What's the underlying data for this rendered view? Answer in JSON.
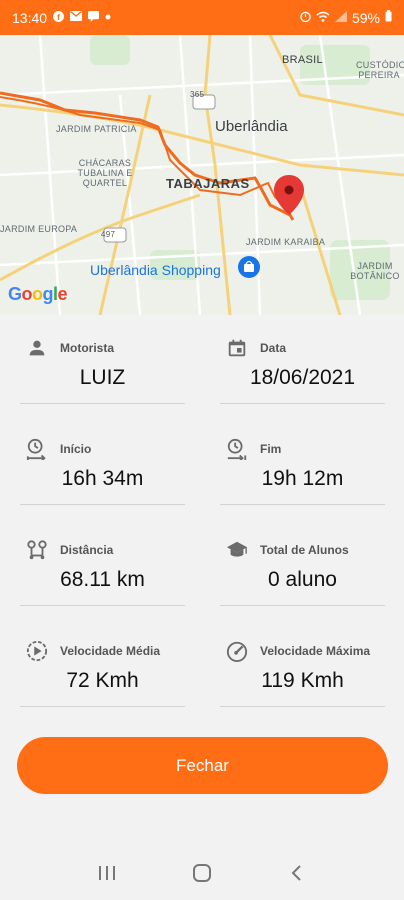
{
  "status_bar": {
    "time": "13:40",
    "battery": "59%",
    "left_icons": [
      "facebook-icon",
      "mail-icon",
      "message-icon",
      "dot-icon"
    ],
    "right_icons": [
      "alarm-icon",
      "wifi-icon",
      "signal-icon",
      "battery-icon"
    ]
  },
  "map": {
    "labels": {
      "brasil": "BRASIL",
      "custodio": "CUSTÓDIO PEREIRA",
      "jardim_patricia": "JARDIM PATRICIA",
      "uberlandia": "Uberlândia",
      "chacaras": "CHÁCARAS TUBALINA E QUARTEL",
      "tabajaras": "TABAJARAS",
      "jardim_europa": "JARDIM EUROPA",
      "jardim_karaiba": "JARDIM KARAIBA",
      "jardim_botanico": "JARDIM BOTÂNICO",
      "shopping": "Uberlândia Shopping",
      "road_365": "365",
      "road_497": "497"
    },
    "google": {
      "letters": [
        "G",
        "o",
        "o",
        "g",
        "l",
        "e"
      ],
      "colors": [
        "#4285F4",
        "#EA4335",
        "#FBBC05",
        "#4285F4",
        "#34A853",
        "#EA4335"
      ]
    },
    "route_color": "#ef6c1e",
    "marker_color": "#e53935"
  },
  "details": {
    "driver": {
      "label": "Motorista",
      "value": "LUIZ",
      "icon": "person-icon"
    },
    "date": {
      "label": "Data",
      "value": "18/06/2021",
      "icon": "calendar-icon"
    },
    "start": {
      "label": "Início",
      "value": "16h 34m",
      "icon": "clock-start-icon"
    },
    "end": {
      "label": "Fim",
      "value": "19h 12m",
      "icon": "clock-end-icon"
    },
    "distance": {
      "label": "Distância",
      "value": "68.11 km",
      "icon": "route-icon"
    },
    "students": {
      "label": "Total de Alunos",
      "value": "0 aluno",
      "icon": "graduation-cap-icon"
    },
    "avg_speed": {
      "label": "Velocidade Média",
      "value": "72 Kmh",
      "icon": "play-circle-icon"
    },
    "max_speed": {
      "label": "Velocidade Máxima",
      "value": "119 Kmh",
      "icon": "speedometer-icon"
    }
  },
  "close_button": {
    "label": "Fechar"
  },
  "colors": {
    "accent": "#ff6d14",
    "icon": "#6b6b6b"
  },
  "nav": [
    "recent-apps-icon",
    "home-icon",
    "back-icon"
  ]
}
